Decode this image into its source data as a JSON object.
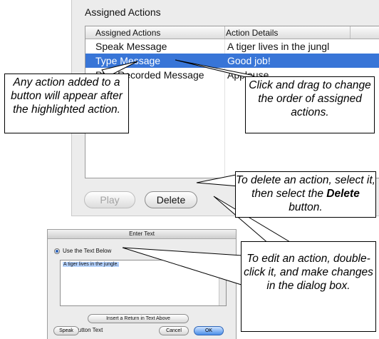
{
  "panel": {
    "title": "Assigned Actions",
    "columns": [
      "Assigned Actions",
      "Action Details"
    ],
    "rows": [
      {
        "action": "Speak Message",
        "details": "A tiger lives in the jungl"
      },
      {
        "action": "Type Message",
        "details": "Good job!",
        "selected": true
      },
      {
        "action": "Play Recorded Message",
        "details": "Applause"
      }
    ],
    "play_label": "Play",
    "delete_label": "Delete"
  },
  "dialog": {
    "title": "Enter Text",
    "use_text_below": "Use the Text Below",
    "text_value": "A tiger lives in the jungle.",
    "insert_return_label": "Insert a Return in Text Above",
    "use_button_text": "Use Button Text",
    "speak_label": "Speak",
    "cancel_label": "Cancel",
    "ok_label": "OK"
  },
  "callouts": {
    "add_action": "Any action added to a button will appear after the highlighted action.",
    "drag_order": "Click and drag to change the order of assigned actions.",
    "delete_prefix": "To delete an action, select it, then select the",
    "delete_bold": "Delete",
    "delete_suffix": "button.",
    "edit_action": "To edit an action, double-click it, and make changes in the dialog box."
  }
}
